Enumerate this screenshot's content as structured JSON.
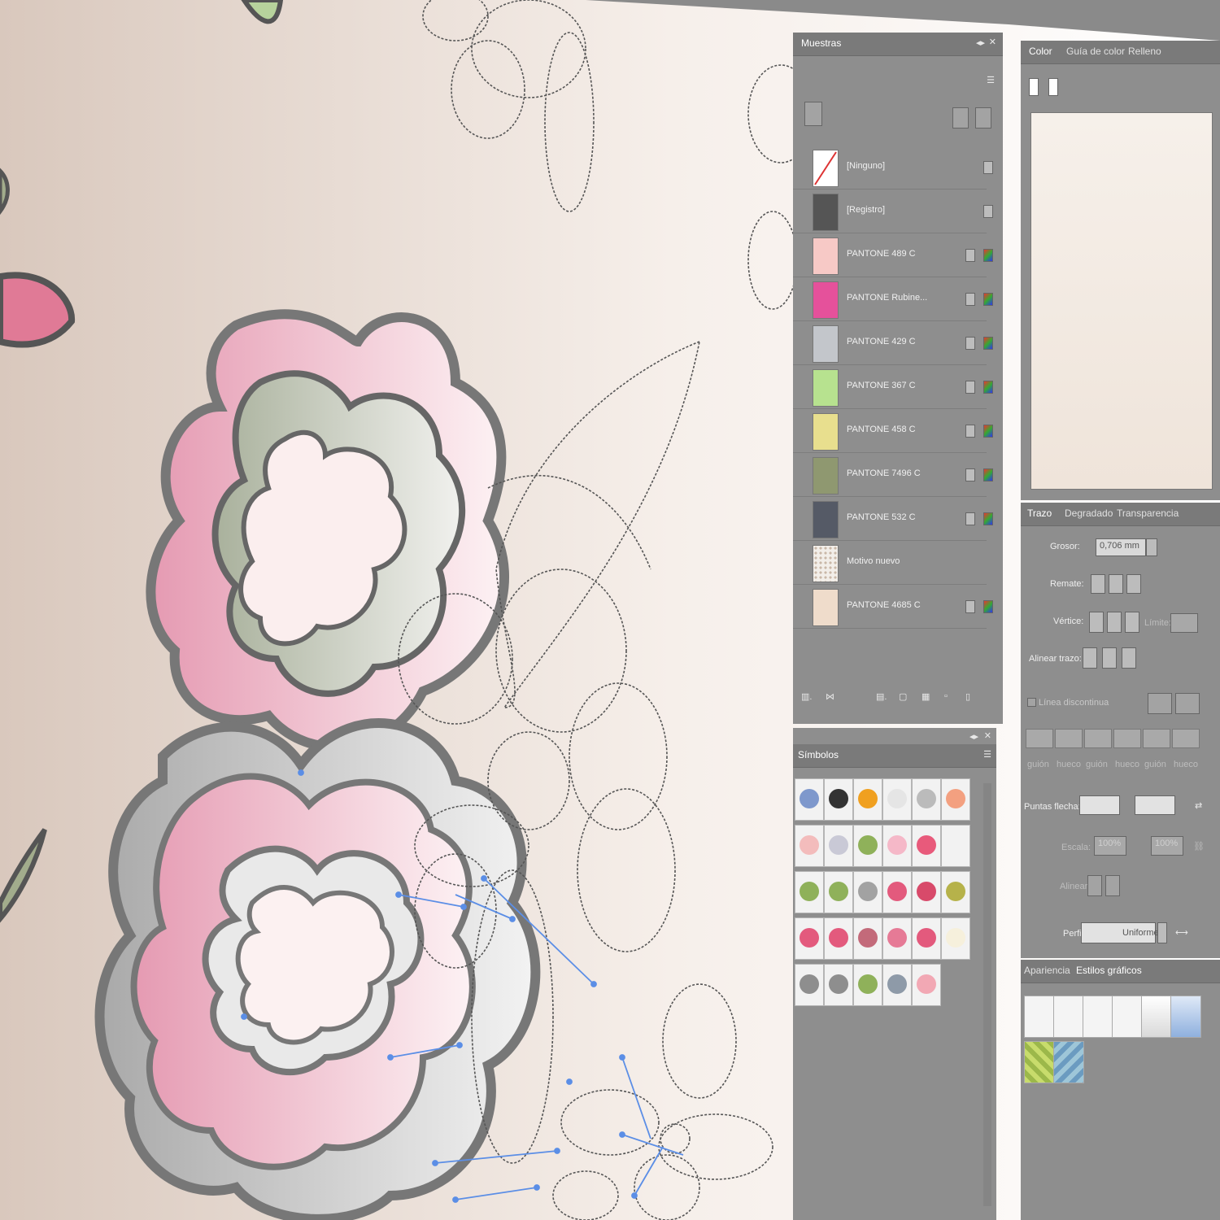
{
  "colors": {
    "panel_bg": "#8e8e8e",
    "accent_pink": "#e79db4",
    "anchor_blue": "#5b8ee6"
  },
  "swatches_panel": {
    "title": "Muestras",
    "rows": [
      {
        "label": "[Ninguno]",
        "color": "#ffffff",
        "none": true
      },
      {
        "label": "[Registro]",
        "color": "#555555"
      },
      {
        "label": "PANTONE 489 C",
        "color": "#f7c9c6"
      },
      {
        "label": "PANTONE Rubine...",
        "color": "#e5519b"
      },
      {
        "label": "PANTONE 429 C",
        "color": "#c3c6cb"
      },
      {
        "label": "PANTONE 367 C",
        "color": "#b7e28f"
      },
      {
        "label": "PANTONE 458 C",
        "color": "#e8df8e"
      },
      {
        "label": "PANTONE 7496 C",
        "color": "#8f9870"
      },
      {
        "label": "PANTONE 532 C",
        "color": "#555a66"
      },
      {
        "label": "Motivo nuevo",
        "color": "#f2eee9",
        "pattern": true
      },
      {
        "label": "PANTONE 4685 C",
        "color": "#efdccb"
      }
    ]
  },
  "symbols_panel": {
    "title": "Símbolos",
    "colors": [
      "#7e98cc",
      "#333333",
      "#f0a020",
      "#e5e5e5",
      "#bbbbbb",
      "#f3a080",
      "#f3bcbc",
      "#c9c9d6",
      "#8fb15a",
      "#f5b8c8",
      "#e85a7b",
      "#f2f2f2",
      "#8fb15a",
      "#8fb15a",
      "#a2a2a2",
      "#e35a7d",
      "#d84a6a",
      "#b6b24a",
      "#e35a7d",
      "#e35a7d",
      "#c36a7a",
      "#e67a96",
      "#e35a7d",
      "#f6f0dc",
      "#8e8e8e",
      "#8e8e8e",
      "#8fb15a",
      "#8e9aa8",
      "#f2a8b4"
    ]
  },
  "color_panel": {
    "tabs": [
      "Color",
      "Guía de color",
      "Relleno"
    ]
  },
  "stroke_panel": {
    "tabs": [
      "Trazo",
      "Degradado",
      "Transparencia"
    ],
    "weight_label": "Grosor:",
    "weight_value": "0,706 mm",
    "cap_label": "Remate:",
    "corner_label": "Vértice:",
    "limit_label": "Límite:",
    "align_label": "Alinear trazo:",
    "dashed_label": "Línea discontinua",
    "dash_labels": [
      "guión",
      "hueco",
      "guión",
      "hueco",
      "guión",
      "hueco"
    ],
    "arrow_label": "Puntas flecha:",
    "scale_label": "Escala:",
    "scale_value_1": "100%",
    "scale_value_2": "100%",
    "align_arrow_label": "Alinear:",
    "profile_label": "Perfil:",
    "profile_value": "Uniforme"
  },
  "graphic_styles_panel": {
    "tabs": [
      "Apariencia",
      "Estilos gráficos"
    ]
  }
}
